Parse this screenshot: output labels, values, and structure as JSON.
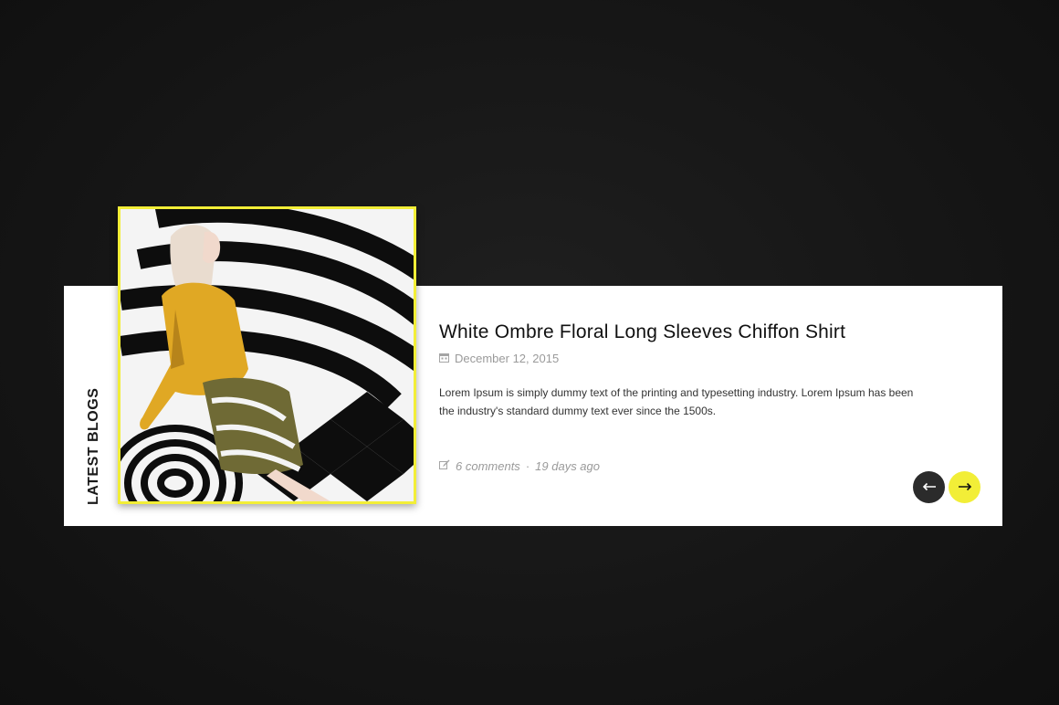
{
  "section": {
    "title": "Latest Blogs"
  },
  "post": {
    "title": "White Ombre Floral Long Sleeves Chiffon Shirt",
    "date": "December 12, 2015",
    "excerpt": "Lorem Ipsum is simply dummy text of the printing and typesetting industry. Lorem Ipsum has been the industry's standard dummy text ever since the 1500s.",
    "comments": "6 comments",
    "separator": "·",
    "time_ago": "19 days ago"
  },
  "icons": {
    "date": "calendar-icon",
    "comments": "edit-icon",
    "prev": "arrow-left-icon",
    "next": "arrow-right-icon"
  },
  "colors": {
    "accent": "#f2ee37",
    "dark": "#2b2b2b",
    "panel": "#ffffff",
    "background": "#161616"
  }
}
